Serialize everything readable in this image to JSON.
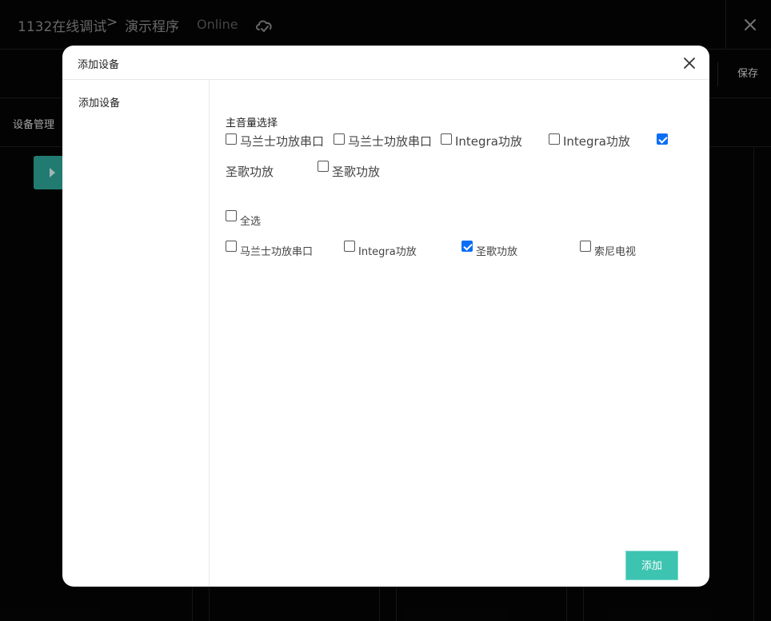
{
  "app": {
    "breadcrumb": {
      "project": "1132在线调试",
      "separator": ">",
      "program": "演示程序"
    },
    "status": "Online",
    "toolbar": {
      "save_label": "保存"
    },
    "tabs": {
      "device_management": "设备管理"
    }
  },
  "modal": {
    "title": "添加设备",
    "sidebar": {
      "items": [
        {
          "label": "添加设备"
        }
      ]
    },
    "master_volume": {
      "title": "主音量选择",
      "options": [
        {
          "label": "马兰士功放串口",
          "checked": false
        },
        {
          "label": "马兰士功放串口",
          "checked": false
        },
        {
          "label": "Integra功放",
          "checked": false
        },
        {
          "label": "Integra功放",
          "checked": false
        },
        {
          "label": "",
          "checked": true
        },
        {
          "label": "圣歌功放",
          "checked": false
        },
        {
          "label": "圣歌功放",
          "checked": false
        }
      ]
    },
    "device_list": {
      "select_all": {
        "label": "全选",
        "checked": false
      },
      "options": [
        {
          "label": "马兰士功放串口",
          "checked": false
        },
        {
          "label": "Integra功放",
          "checked": false
        },
        {
          "label": "圣歌功放",
          "checked": true
        },
        {
          "label": "索尼电视",
          "checked": false
        }
      ]
    },
    "add_label": "添加"
  },
  "colors": {
    "accent": "#3dc4b1",
    "checkbox_checked": "#0b6ef5",
    "background": "#050505"
  }
}
